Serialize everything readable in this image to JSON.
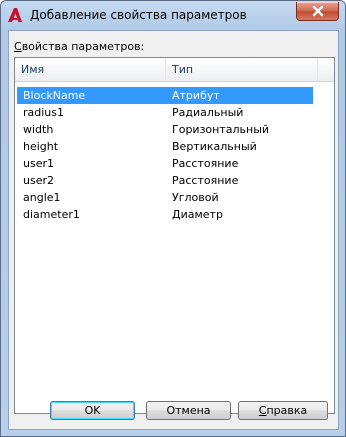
{
  "window": {
    "title": "Добавление свойства параметров"
  },
  "list_label_prefix": "С",
  "list_label_rest": "войства параметров:",
  "columns": {
    "name": "Имя",
    "type": "Тип"
  },
  "rows": [
    {
      "name": "BlockName",
      "type": "Атрибут",
      "selected": true
    },
    {
      "name": "radius1",
      "type": "Радиальный"
    },
    {
      "name": "width",
      "type": "Горизонтальный"
    },
    {
      "name": "height",
      "type": "Вертикальный"
    },
    {
      "name": "user1",
      "type": "Расстояние"
    },
    {
      "name": "user2",
      "type": "Расстояние"
    },
    {
      "name": "angle1",
      "type": "Угловой"
    },
    {
      "name": "diameter1",
      "type": "Диаметр"
    }
  ],
  "buttons": {
    "ok": "OK",
    "cancel": "Отмена",
    "help_prefix": "С",
    "help_rest": "правка"
  },
  "colors": {
    "selection": "#3399ff",
    "app_icon": "#c8102e"
  },
  "icons": {
    "app": "autocad-logo-icon",
    "close": "close-icon"
  }
}
